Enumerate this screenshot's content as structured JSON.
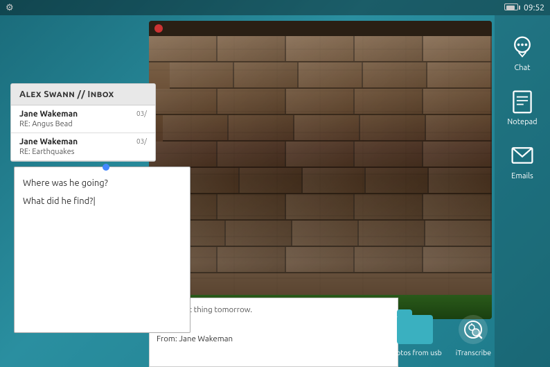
{
  "topbar": {
    "time": "09:52"
  },
  "inbox": {
    "title": "Alex Swann // Inbox",
    "items": [
      {
        "sender": "Jane Wakeman",
        "date": "03/",
        "subject": "RE: Angus Bead"
      },
      {
        "sender": "Jane Wakeman",
        "date": "03/",
        "subject": "RE: Earthquakes"
      }
    ]
  },
  "note": {
    "line1": "Where was he going?",
    "line2": "",
    "line3": "What did he find?"
  },
  "email_panel": {
    "text": "them first thing tomorrow.",
    "separator": "--",
    "from_label": "From: Jane Wakeman"
  },
  "dock": {
    "chat_label": "Chat",
    "notepad_label": "Notepad",
    "emails_label": "Emails"
  },
  "bottom_dock": {
    "usb_label": "photos from usb",
    "transcribe_label": "iTranscribe"
  }
}
